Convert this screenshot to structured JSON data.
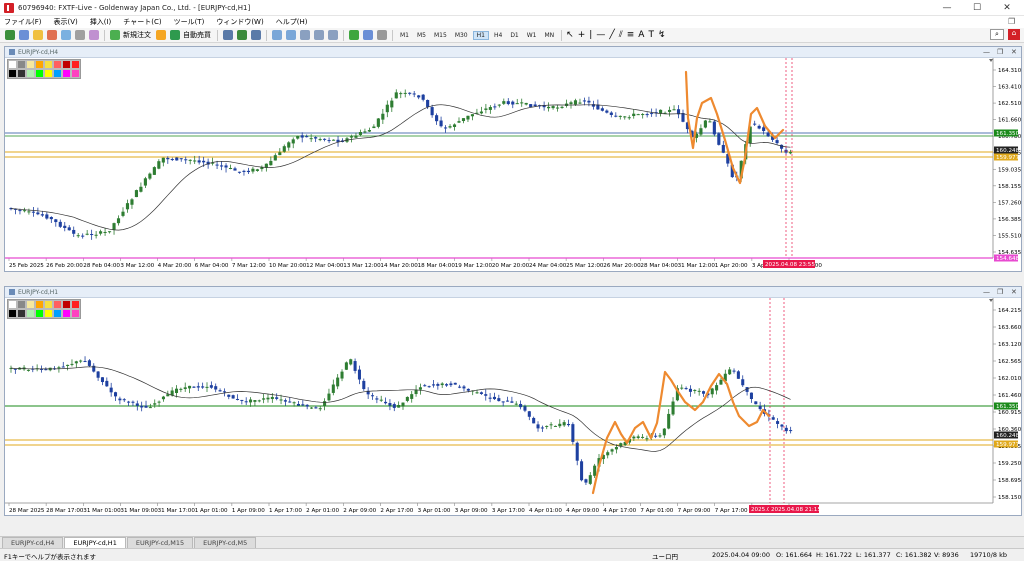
{
  "window": {
    "title": "60796940: FXTF-Live - Goldenway Japan Co., Ltd. - [EURJPY-cd,H1]",
    "minimize": "—",
    "maximize": "☐",
    "close": "✕"
  },
  "menu": [
    "ファイル(F)",
    "表示(V)",
    "挿入(I)",
    "チャート(C)",
    "ツール(T)",
    "ウィンドウ(W)",
    "ヘルプ(H)"
  ],
  "toolbar": {
    "new_order": "新規注文",
    "auto_trade": "自動売買",
    "timeframes": [
      "M1",
      "M5",
      "M15",
      "M30",
      "H1",
      "H4",
      "D1",
      "W1",
      "MN"
    ],
    "active_timeframe": "H1"
  },
  "colors": {
    "bull": "#2e7d32",
    "bear": "#1e40a0",
    "ma": "#333333",
    "accent": "#ee8a30",
    "mark": "#e8184a",
    "green_line": "#1a8a1a",
    "blue_line": "#7792c2",
    "gold_line": "#e0a91c",
    "pink_line": "#e84ad0"
  },
  "top_chart": {
    "title": "EURJPY-cd,H4",
    "price_labels": [
      "164.310",
      "163.410",
      "162.510",
      "161.660",
      "160.780",
      "159.905",
      "159.035",
      "158.155",
      "157.260",
      "156.385",
      "155.510",
      "154.635"
    ],
    "tags": {
      "green": "161.350",
      "bid": "160.248",
      "gold": "159.977",
      "pink": "154.648"
    },
    "dates": [
      "25 Feb 2025",
      "26 Feb 20:00",
      "28 Feb 04:00",
      "3 Mar 12:00",
      "4 Mar 20:00",
      "6 Mar 04:00",
      "7 Mar 12:00",
      "10 Mar 20:00",
      "12 Mar 04:00",
      "13 Mar 12:00",
      "14 Mar 20:00",
      "18 Mar 04:00",
      "19 Mar 12:00",
      "20 Mar 20:00",
      "24 Mar 04:00",
      "25 Mar 12:00",
      "26 Mar 20:00",
      "28 Mar 04:00",
      "31 Mar 12:00",
      "1 Apr 20:00",
      "3 Apr 04:00",
      "4 Apr 12:00"
    ],
    "cursor_date": "2025.04.08 23:55"
  },
  "bottom_chart": {
    "title": "EURJPY-cd,H1",
    "price_labels": [
      "164.215",
      "163.660",
      "163.120",
      "162.565",
      "162.010",
      "161.460",
      "160.915",
      "160.360",
      "159.805",
      "159.250",
      "158.695",
      "158.150"
    ],
    "tags": {
      "green": "161.350",
      "bid": "160.248",
      "gold": "159.977"
    },
    "dates": [
      "28 Mar 2025",
      "28 Mar 17:00",
      "31 Mar 01:00",
      "31 Mar 09:00",
      "31 Mar 17:00",
      "1 Apr 01:00",
      "1 Apr 09:00",
      "1 Apr 17:00",
      "2 Apr 01:00",
      "2 Apr 09:00",
      "2 Apr 17:00",
      "3 Apr 01:00",
      "3 Apr 09:00",
      "3 Apr 17:00",
      "4 Apr 01:00",
      "4 Apr 09:00",
      "4 Apr 17:00",
      "7 Apr 01:00",
      "7 Apr 09:00",
      "7 Apr 17:00",
      "8 Apr 01:00",
      "8 Apr"
    ],
    "cursor_date_a": "2025.0",
    "cursor_date_b": "2025.04.08 21:15"
  },
  "tabs": [
    "EURJPY-cd,H4",
    "EURJPY-cd,H1",
    "EURJPY-cd,M15",
    "EURJPY-cd,M5"
  ],
  "active_tab": "EURJPY-cd,H1",
  "status": {
    "help": "F1キーでヘルプが表示されます",
    "currency": "ユーロ円",
    "time": "2025.04.04 09:00",
    "open": "O: 161.664",
    "high": "H: 161.722",
    "low": "L: 161.377",
    "close": "C: 161.382",
    "volume": "V: 8936",
    "traffic": "19710/8 kb"
  }
}
